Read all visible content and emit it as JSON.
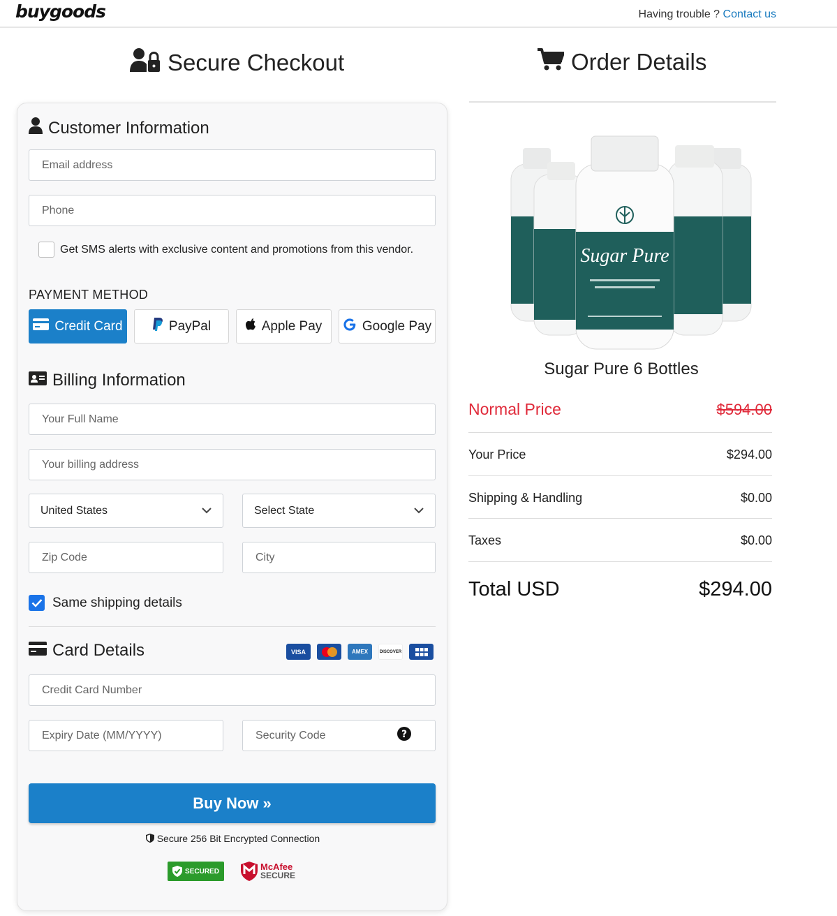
{
  "topbar": {
    "logo": "buygoods",
    "help_text": "Having trouble ?",
    "contact_link": "Contact us"
  },
  "headers": {
    "checkout": "Secure Checkout",
    "order": "Order Details"
  },
  "customer": {
    "title": "Customer Information",
    "email_placeholder": "Email address",
    "phone_placeholder": "Phone",
    "sms_label": "Get SMS alerts with exclusive content and promotions from this vendor."
  },
  "payment": {
    "label": "PAYMENT METHOD",
    "methods": [
      {
        "label": "Credit Card",
        "icon": "credit-card-icon",
        "active": true
      },
      {
        "label": "PayPal",
        "icon": "paypal-icon",
        "active": false
      },
      {
        "label": "Apple Pay",
        "icon": "apple-icon",
        "active": false
      },
      {
        "label": "Google Pay",
        "icon": "google-icon",
        "active": false
      }
    ]
  },
  "billing": {
    "title": "Billing Information",
    "name_placeholder": "Your Full Name",
    "address_placeholder": "Your billing address",
    "country": "United States",
    "state": "Select State",
    "zip_placeholder": "Zip Code",
    "city_placeholder": "City",
    "same_shipping": "Same shipping details"
  },
  "card": {
    "title": "Card Details",
    "logos": [
      "VISA",
      "MC",
      "AMEX",
      "DISCOVER",
      "DINERS"
    ],
    "number_placeholder": "Credit Card Number",
    "expiry_placeholder": "Expiry Date (MM/YYYY)",
    "cvv_placeholder": "Security Code"
  },
  "buy_button": "Buy Now »",
  "secure_text": "Secure 256 Bit Encrypted Connection",
  "badges": {
    "secured": "SECURED",
    "mcafee_top": "McAfee",
    "mcafee_bottom": "SECURE"
  },
  "order": {
    "product_name": "Sugar Pure 6 Bottles",
    "bottle_label": "Sugar Pure",
    "rows": {
      "normal_label": "Normal Price",
      "normal_value": "$594.00",
      "your_label": "Your Price",
      "your_value": "$294.00",
      "shipping_label": "Shipping & Handling",
      "shipping_value": "$0.00",
      "taxes_label": "Taxes",
      "taxes_value": "$0.00",
      "total_label": "Total USD",
      "total_value": "$294.00"
    }
  },
  "colors": {
    "accent": "#1b80c9",
    "price_red": "#e02a3a",
    "bottle_green": "#1f5f5b"
  }
}
